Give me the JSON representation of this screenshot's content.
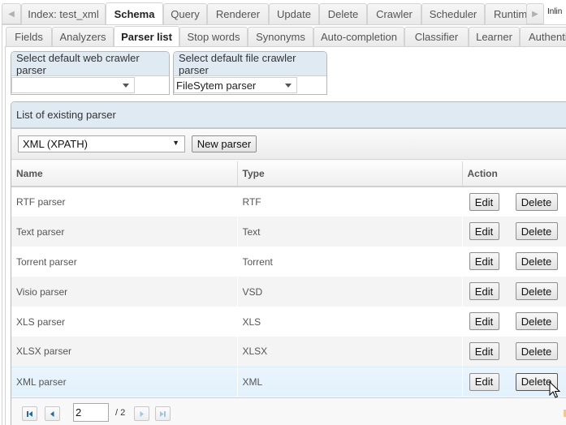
{
  "top_tabs": {
    "scroll_left_icon": "chevron-left-icon",
    "scroll_right_icon": "chevron-right-icon",
    "items": [
      {
        "label": "Index: test_xml",
        "active": false
      },
      {
        "label": "Schema",
        "active": true
      },
      {
        "label": "Query",
        "active": false
      },
      {
        "label": "Renderer",
        "active": false
      },
      {
        "label": "Update",
        "active": false
      },
      {
        "label": "Delete",
        "active": false
      },
      {
        "label": "Crawler",
        "active": false
      },
      {
        "label": "Scheduler",
        "active": false
      },
      {
        "label": "Runtim",
        "active": false
      }
    ],
    "trailing_label": "Inlin"
  },
  "schema_tabs": {
    "items": [
      {
        "label": "Fields",
        "active": false
      },
      {
        "label": "Analyzers",
        "active": false
      },
      {
        "label": "Parser list",
        "active": true
      },
      {
        "label": "Stop words",
        "active": false
      },
      {
        "label": "Synonyms",
        "active": false
      },
      {
        "label": "Auto-completion",
        "active": false
      },
      {
        "label": "Classifier",
        "active": false
      },
      {
        "label": "Learner",
        "active": false
      },
      {
        "label": "Authenti",
        "active": false
      }
    ]
  },
  "default_parsers": {
    "web": {
      "title": "Select default web crawler parser",
      "value": ""
    },
    "file": {
      "title": "Select default file crawler parser",
      "value": "FileSytem parser"
    }
  },
  "parser_list": {
    "title": "List of existing parser",
    "type_select": {
      "value": "XML (XPATH)"
    },
    "new_button": "New parser",
    "columns": {
      "name": "Name",
      "type": "Type",
      "action": "Action"
    },
    "rows": [
      {
        "name": "RTF parser",
        "type": "RTF"
      },
      {
        "name": "Text parser",
        "type": "Text"
      },
      {
        "name": "Torrent parser",
        "type": "Torrent"
      },
      {
        "name": "Visio parser",
        "type": "VSD"
      },
      {
        "name": "XLS parser",
        "type": "XLS"
      },
      {
        "name": "XLSX parser",
        "type": "XLSX"
      },
      {
        "name": "XML parser",
        "type": "XML"
      }
    ],
    "edit_label": "Edit",
    "delete_label": "Delete",
    "hovered_row": 6
  },
  "pager": {
    "current_page": "2",
    "total_label": "/ 2",
    "first_icon": "first-page-icon",
    "prev_icon": "prev-page-icon",
    "next_icon": "next-page-icon",
    "last_icon": "last-page-icon"
  },
  "colors": {
    "panel_header_bg": "#dfeaf3",
    "hover_row_bg": "#e6f3fd",
    "pager_icon_active": "#1a6ea8",
    "pager_icon_disabled": "#9cc6e2"
  }
}
